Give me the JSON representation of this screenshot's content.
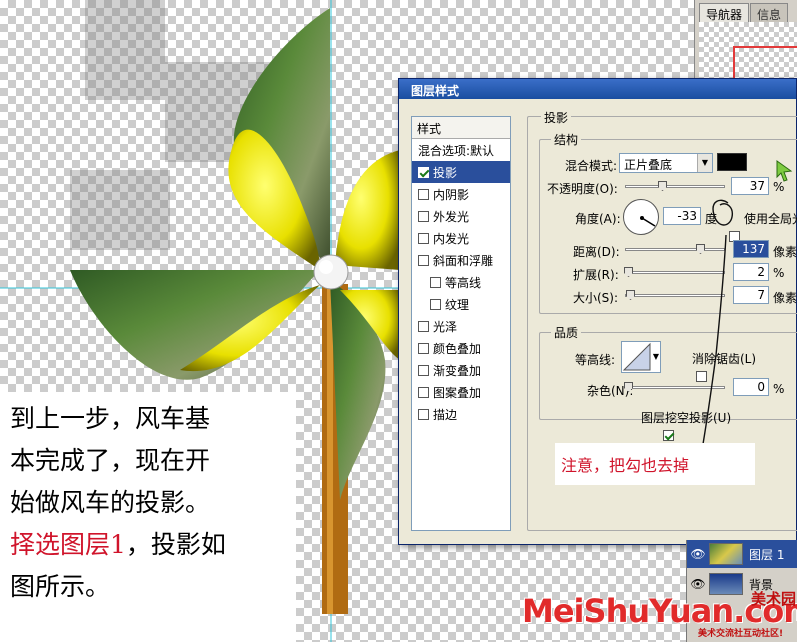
{
  "tutorial": {
    "line1": "到上一步，风车基",
    "line2": "本完成了，现在开",
    "line3": "始做风车的投影。",
    "line4_red": "择选图层1",
    "line4_rest": "，投影如",
    "line5": "图所示。"
  },
  "navigator": {
    "tab1": "导航器",
    "tab2": "信息"
  },
  "dialog": {
    "title": "图层样式",
    "styles_header": "样式",
    "styles": [
      {
        "label": "混合选项:默认",
        "checkbox": false
      },
      {
        "label": "投影",
        "checkbox": true,
        "checked": true,
        "selected": true
      },
      {
        "label": "内阴影",
        "checkbox": true,
        "checked": false
      },
      {
        "label": "外发光",
        "checkbox": true,
        "checked": false
      },
      {
        "label": "内发光",
        "checkbox": true,
        "checked": false
      },
      {
        "label": "斜面和浮雕",
        "checkbox": true,
        "checked": false
      },
      {
        "label": "等高线",
        "checkbox": true,
        "checked": false,
        "indent": true
      },
      {
        "label": "纹理",
        "checkbox": true,
        "checked": false,
        "indent": true
      },
      {
        "label": "光泽",
        "checkbox": true,
        "checked": false
      },
      {
        "label": "颜色叠加",
        "checkbox": true,
        "checked": false
      },
      {
        "label": "渐变叠加",
        "checkbox": true,
        "checked": false
      },
      {
        "label": "图案叠加",
        "checkbox": true,
        "checked": false
      },
      {
        "label": "描边",
        "checkbox": true,
        "checked": false
      }
    ],
    "section_title": "投影",
    "structure": {
      "title": "结构",
      "blend_mode_label": "混合模式:",
      "blend_mode_value": "正片叠底",
      "shadow_color": "#000000",
      "opacity_label": "不透明度(O):",
      "opacity_value": "37",
      "opacity_unit": "%",
      "angle_label": "角度(A):",
      "angle_value": "-33",
      "angle_unit": "度",
      "global_light_label": "使用全局光",
      "distance_label": "距离(D):",
      "distance_value": "137",
      "distance_unit": "像素",
      "spread_label": "扩展(R):",
      "spread_value": "2",
      "spread_unit": "%",
      "size_label": "大小(S):",
      "size_value": "7",
      "size_unit": "像素"
    },
    "quality": {
      "title": "品质",
      "contour_label": "等高线:",
      "antialias_label": "消除锯齿(L)",
      "noise_label": "杂色(N):",
      "noise_value": "0",
      "noise_unit": "%",
      "knockout_label": "图层挖空投影(U)"
    }
  },
  "annotation": {
    "note": "注意，把勾也去掉"
  },
  "layers": {
    "layer1": "图层 1",
    "layer2": "背景"
  },
  "watermark": {
    "main": "MeiShuYuan.com",
    "brand": "美术园",
    "sub": "美术交流社互动社区!"
  }
}
